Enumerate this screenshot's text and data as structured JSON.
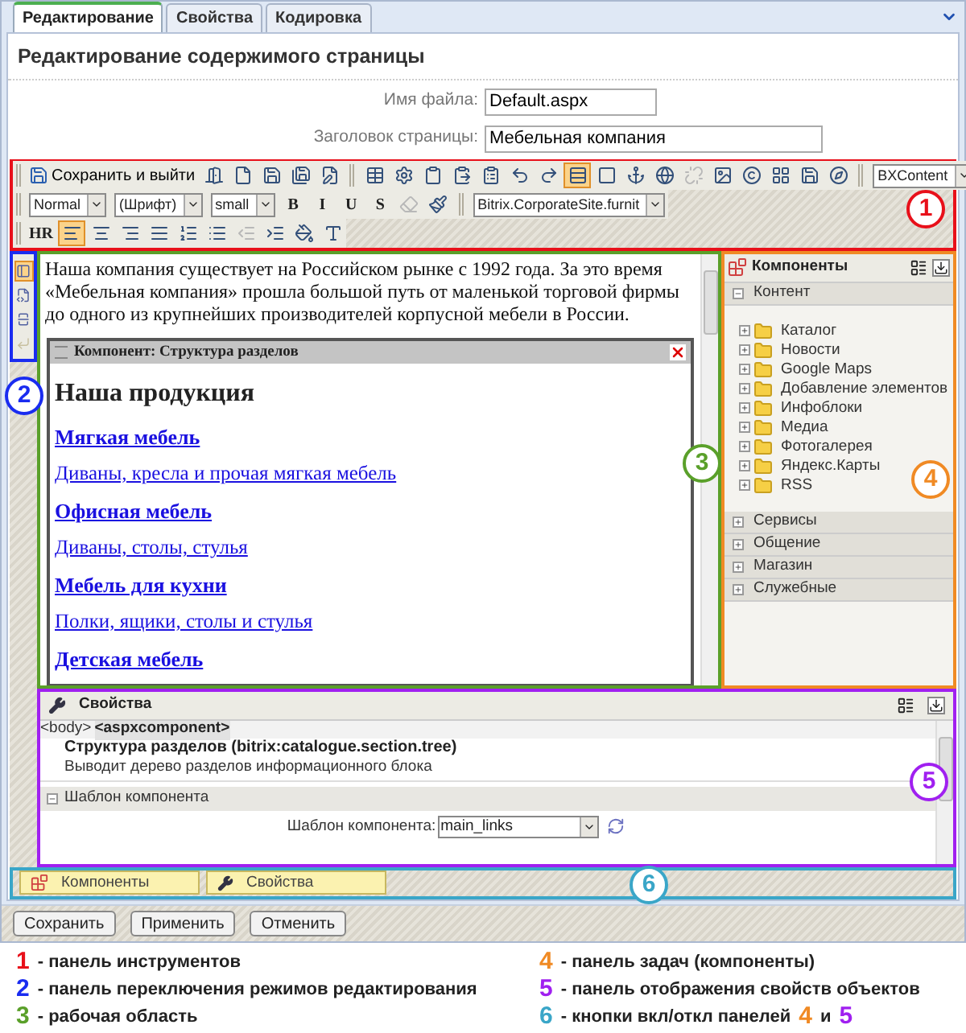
{
  "tabs": [
    {
      "label": "Редактирование",
      "selected": true
    },
    {
      "label": "Свойства",
      "selected": false
    },
    {
      "label": "Кодировка",
      "selected": false
    }
  ],
  "page_title": "Редактирование содержимого страницы",
  "fields": [
    {
      "label": "Имя файла:",
      "value": "Default.aspx"
    },
    {
      "label": "Заголовок страницы:",
      "value": "Мебельная компания"
    }
  ],
  "toolbar": {
    "badge": {
      "number": "1",
      "color": "#e8101a"
    },
    "rows": [
      [
        {
          "kind": "button",
          "label": "Сохранить и выйти"
        },
        {
          "kind": "icon",
          "selected": false,
          "disabled": false
        },
        {
          "kind": "icon",
          "selected": false,
          "disabled": false
        },
        {
          "kind": "icon",
          "selected": false,
          "disabled": false
        },
        {
          "kind": "icon",
          "selected": false,
          "disabled": false
        },
        {
          "kind": "icon",
          "selected": false,
          "disabled": false
        },
        {
          "kind": "separator"
        },
        {
          "kind": "icon",
          "selected": false,
          "disabled": false
        },
        {
          "kind": "icon",
          "selected": false,
          "disabled": false
        },
        {
          "kind": "icon",
          "selected": false,
          "disabled": false
        },
        {
          "kind": "icon",
          "selected": false,
          "disabled": false
        },
        {
          "kind": "icon",
          "selected": false,
          "disabled": false
        },
        {
          "kind": "icon",
          "selected": false,
          "disabled": false
        },
        {
          "kind": "icon",
          "selected": false,
          "disabled": false
        },
        {
          "kind": "icon",
          "selected": true,
          "disabled": false
        },
        {
          "kind": "icon",
          "selected": false,
          "disabled": false
        },
        {
          "kind": "icon",
          "selected": false,
          "disabled": false
        },
        {
          "kind": "icon",
          "selected": false,
          "disabled": false
        },
        {
          "kind": "icon",
          "selected": false,
          "disabled": true
        },
        {
          "kind": "icon",
          "selected": false,
          "disabled": false
        },
        {
          "kind": "icon",
          "selected": false,
          "disabled": false
        },
        {
          "kind": "icon",
          "selected": false,
          "disabled": false
        },
        {
          "kind": "icon",
          "selected": false,
          "disabled": false
        },
        {
          "kind": "icon",
          "selected": false,
          "disabled": false
        },
        {
          "kind": "separator"
        },
        {
          "kind": "select",
          "value": "BXContent"
        }
      ],
      [
        {
          "kind": "select",
          "value": "Normal"
        },
        {
          "kind": "select",
          "value": "(Шрифт)"
        },
        {
          "kind": "select",
          "value": "small"
        },
        {
          "kind": "format",
          "label": "B",
          "selected": false,
          "disabled": false
        },
        {
          "kind": "format",
          "label": "I",
          "selected": false,
          "disabled": false
        },
        {
          "kind": "format",
          "label": "U",
          "selected": false,
          "disabled": false
        },
        {
          "kind": "format",
          "label": "S",
          "selected": false,
          "disabled": false
        },
        {
          "kind": "icon",
          "selected": false,
          "disabled": true
        },
        {
          "kind": "icon",
          "selected": false,
          "disabled": false
        },
        {
          "kind": "separator"
        },
        {
          "kind": "select",
          "value": "Bitrix.CorporateSite.furnit"
        }
      ],
      [
        {
          "kind": "format",
          "label": "HR",
          "selected": false,
          "disabled": false
        },
        {
          "kind": "icon",
          "selected": true,
          "disabled": false
        },
        {
          "kind": "icon",
          "selected": false,
          "disabled": false
        },
        {
          "kind": "icon",
          "selected": false,
          "disabled": false
        },
        {
          "kind": "icon",
          "selected": false,
          "disabled": false
        },
        {
          "kind": "icon",
          "selected": false,
          "disabled": false
        },
        {
          "kind": "icon",
          "selected": false,
          "disabled": false
        },
        {
          "kind": "icon",
          "selected": false,
          "disabled": true
        },
        {
          "kind": "icon",
          "selected": false,
          "disabled": false
        },
        {
          "kind": "icon",
          "selected": false,
          "disabled": false
        },
        {
          "kind": "icon",
          "selected": false,
          "disabled": false
        }
      ]
    ]
  },
  "mode_panel": {
    "badge": {
      "number": "2",
      "color": "#1a2cf0"
    },
    "buttons": [
      {
        "selected": true,
        "disabled": false
      },
      {
        "selected": false,
        "disabled": false
      },
      {
        "selected": false,
        "disabled": false
      },
      {
        "selected": false,
        "disabled": true
      }
    ]
  },
  "workspace": {
    "badge": {
      "number": "3",
      "color": "#5aa02a"
    },
    "paragraph": "Наша компания существует на Российском рынке с 1992 года. За это время «Мебельная компания» прошла большой путь от маленькой торговой фирмы до одного из крупнейших производителей корпусной мебели в России.",
    "component": {
      "title": "Компонент: Структура разделов",
      "heading": "Наша продукция",
      "links": [
        {
          "kind": "section",
          "label": "Мягкая мебель"
        },
        {
          "kind": "subsection",
          "label": "Диваны, кресла и прочая мягкая мебель"
        },
        {
          "kind": "section",
          "label": "Офисная мебель"
        },
        {
          "kind": "subsection",
          "label": "Диваны, столы, стулья"
        },
        {
          "kind": "section",
          "label": "Мебель для кухни"
        },
        {
          "kind": "subsection",
          "label": "Полки, ящики, столы и стулья"
        },
        {
          "kind": "section",
          "label": "Детская мебель"
        }
      ]
    }
  },
  "components_panel": {
    "badge": {
      "number": "4",
      "color": "#f08a24"
    },
    "title": "Компоненты",
    "groups": [
      {
        "label": "Контент",
        "expanded": true,
        "children": [
          {
            "label": "Каталог",
            "expanded": false
          },
          {
            "label": "Новости",
            "expanded": false
          },
          {
            "label": "Google Maps",
            "expanded": false
          },
          {
            "label": "Добавление элементов",
            "expanded": false
          },
          {
            "label": "Инфоблоки",
            "expanded": false
          },
          {
            "label": "Медиа",
            "expanded": false
          },
          {
            "label": "Фотогалерея",
            "expanded": false
          },
          {
            "label": "Яндекс.Карты",
            "expanded": false
          },
          {
            "label": "RSS",
            "expanded": false
          }
        ]
      },
      {
        "label": "Сервисы",
        "expanded": false
      },
      {
        "label": "Общение",
        "expanded": false
      },
      {
        "label": "Магазин",
        "expanded": false
      },
      {
        "label": "Служебные",
        "expanded": false
      }
    ]
  },
  "properties_panel": {
    "badge": {
      "number": "5",
      "color": "#a020f0"
    },
    "title": "Свойства",
    "breadcrumb": [
      {
        "label": "<body>",
        "selected": false
      },
      {
        "label": "<aspxcomponent>",
        "selected": true
      }
    ],
    "component_name": "Структура разделов (bitrix:catalogue.section.tree)",
    "component_description": "Выводит дерево разделов информационного блока",
    "sections": [
      {
        "label": "Шаблон компонента",
        "expanded": true,
        "field_label": "Шаблон компонента:",
        "field_value": "main_links"
      }
    ]
  },
  "panel_toggles": {
    "badge": {
      "number": "6",
      "color": "#3aa6c8"
    },
    "buttons": [
      {
        "label": "Компоненты"
      },
      {
        "label": "Свойства"
      }
    ]
  },
  "footer_buttons": [
    "Сохранить",
    "Применить",
    "Отменить"
  ],
  "legend": [
    {
      "number": "1",
      "color": "#e8101a",
      "text": "- панель инструментов"
    },
    {
      "number": "2",
      "color": "#1a2cf0",
      "text": "- панель переключения режимов редактирования"
    },
    {
      "number": "3",
      "color": "#5aa02a",
      "text": "- рабочая область"
    },
    {
      "number": "4",
      "color": "#f08a24",
      "text": "- панель задач (компоненты)"
    },
    {
      "number": "5",
      "color": "#a020f0",
      "text": "- панель отображения свойств объектов"
    },
    {
      "number": "6",
      "color": "#3aa6c8",
      "text": "- кнопки вкл/откл панелей",
      "refs": [
        {
          "number": "4",
          "color": "#f08a24"
        },
        {
          "number": "5",
          "color": "#a020f0"
        }
      ],
      "joiner": "и"
    }
  ]
}
